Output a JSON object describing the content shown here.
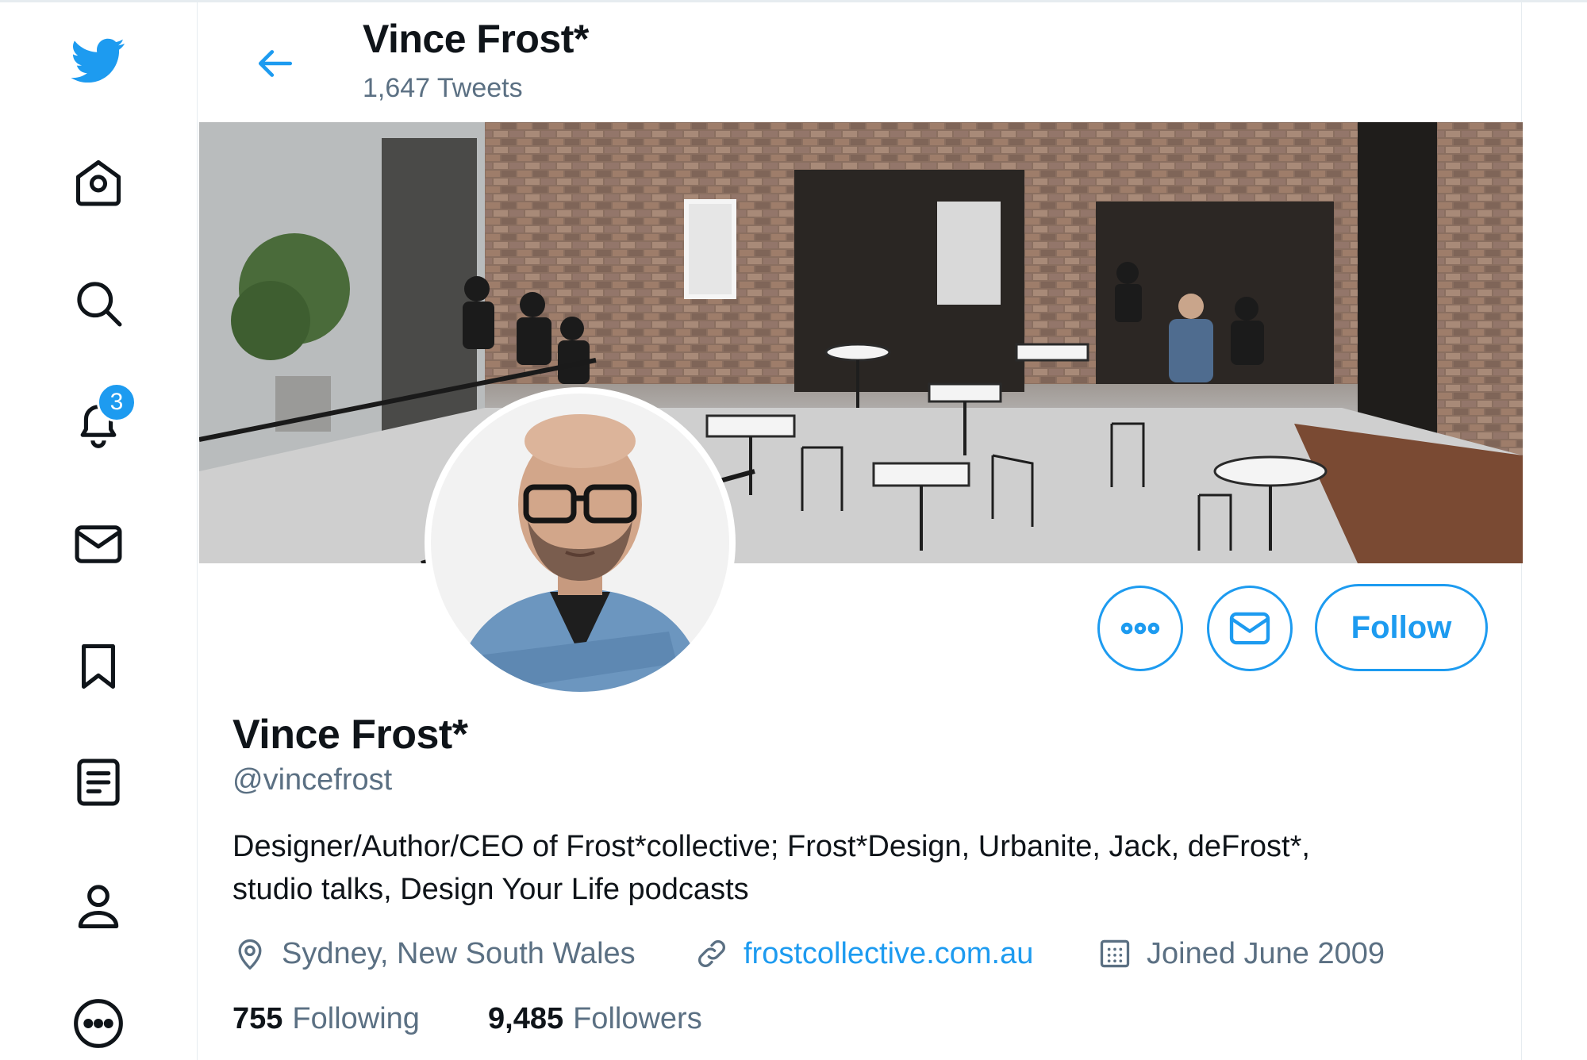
{
  "nav": {
    "items": [
      {
        "icon": "twitter-bird-icon"
      },
      {
        "icon": "home-icon"
      },
      {
        "icon": "search-icon"
      },
      {
        "icon": "bell-icon"
      },
      {
        "icon": "mail-icon"
      },
      {
        "icon": "bookmark-icon"
      },
      {
        "icon": "list-icon"
      },
      {
        "icon": "profile-icon"
      },
      {
        "icon": "more-icon"
      }
    ],
    "notification_count": "3"
  },
  "header": {
    "title": "Vince Frost*",
    "tweet_count": "1,647 Tweets"
  },
  "actions": {
    "follow_label": "Follow"
  },
  "profile": {
    "name": "Vince Frost*",
    "handle": "@vincefrost",
    "bio_line1": "Designer/Author/CEO of Frost*collective; Frost*Design, Urbanite, Jack, deFrost*,",
    "bio_line2": "studio talks, Design Your Life podcasts",
    "location": "Sydney, New South Wales",
    "website": "frostcollective.com.au",
    "joined": "Joined June 2009",
    "following_count": "755",
    "following_label": "Following",
    "followers_count": "9,485",
    "followers_label": "Followers"
  },
  "colors": {
    "accent": "#1d9bf0",
    "secondary_text": "#5b7083",
    "primary_text": "#0f1419"
  }
}
